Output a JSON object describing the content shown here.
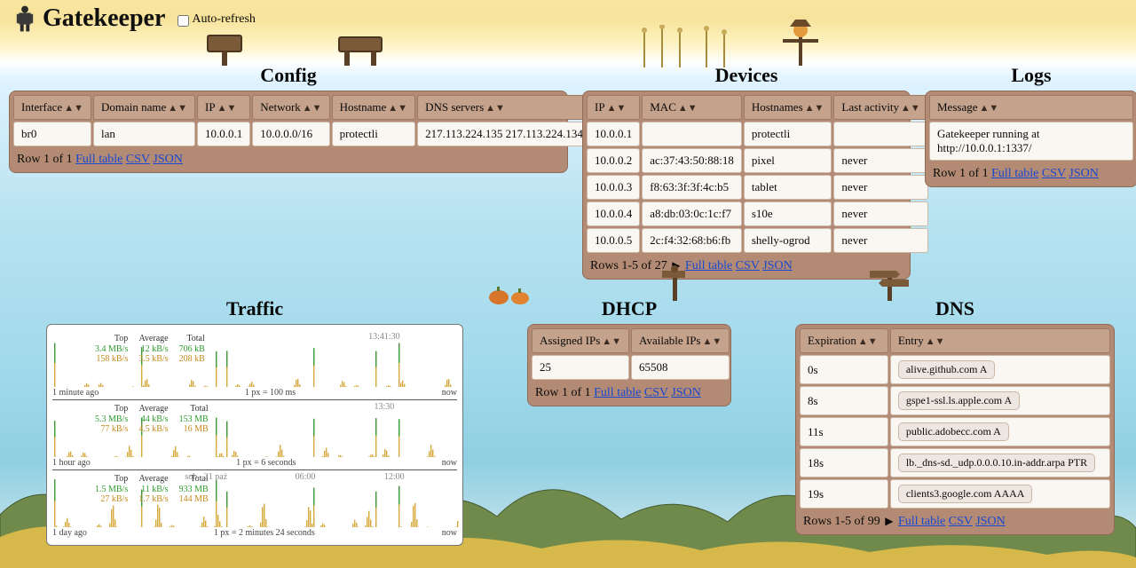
{
  "app": {
    "title": "Gatekeeper",
    "autorefresh_label": "Auto-refresh"
  },
  "config": {
    "title": "Config",
    "headers": {
      "interface": "Interface",
      "domain": "Domain name",
      "ip": "IP",
      "network": "Network",
      "hostname": "Hostname",
      "dns": "DNS servers"
    },
    "rows": [
      {
        "interface": "br0",
        "domain": "lan",
        "ip": "10.0.0.1",
        "network": "10.0.0.0/16",
        "hostname": "protectli",
        "dns": "217.113.224.135 217.113.224.134"
      }
    ],
    "footer": {
      "range": "Row 1 of 1",
      "full": "Full table",
      "csv": "CSV",
      "json": "JSON"
    }
  },
  "devices": {
    "title": "Devices",
    "headers": {
      "ip": "IP",
      "mac": "MAC",
      "hostnames": "Hostnames",
      "last": "Last activity"
    },
    "rows": [
      {
        "ip": "10.0.0.1",
        "mac": "",
        "hostnames": "protectli",
        "last": ""
      },
      {
        "ip": "10.0.0.2",
        "mac": "ac:37:43:50:88:18",
        "hostnames": "pixel",
        "last": "never"
      },
      {
        "ip": "10.0.0.3",
        "mac": "f8:63:3f:3f:4c:b5",
        "hostnames": "tablet",
        "last": "never"
      },
      {
        "ip": "10.0.0.4",
        "mac": "a8:db:03:0c:1c:f7",
        "hostnames": "s10e",
        "last": "never"
      },
      {
        "ip": "10.0.0.5",
        "mac": "2c:f4:32:68:b6:fb",
        "hostnames": "shelly-ogrod",
        "last": "never"
      }
    ],
    "footer": {
      "range": "Rows 1-5 of 27",
      "full": "Full table",
      "csv": "CSV",
      "json": "JSON"
    }
  },
  "logs": {
    "title": "Logs",
    "headers": {
      "message": "Message"
    },
    "rows": [
      {
        "message": "Gatekeeper running at http://10.0.0.1:1337/"
      }
    ],
    "footer": {
      "range": "Row 1 of 1",
      "full": "Full table",
      "csv": "CSV",
      "json": "JSON"
    }
  },
  "dhcp": {
    "title": "DHCP",
    "headers": {
      "assigned": "Assigned IPs",
      "available": "Available IPs"
    },
    "rows": [
      {
        "assigned": "25",
        "available": "65508"
      }
    ],
    "footer": {
      "range": "Row 1 of 1",
      "full": "Full table",
      "csv": "CSV",
      "json": "JSON"
    }
  },
  "dns": {
    "title": "DNS",
    "headers": {
      "expiration": "Expiration",
      "entry": "Entry"
    },
    "rows": [
      {
        "expiration": "0s",
        "entry": "alive.github.com A"
      },
      {
        "expiration": "8s",
        "entry": "gspe1-ssl.ls.apple.com A"
      },
      {
        "expiration": "11s",
        "entry": "public.adobecc.com A"
      },
      {
        "expiration": "18s",
        "entry": "lb._dns-sd._udp.0.0.0.10.in-addr.arpa PTR"
      },
      {
        "expiration": "19s",
        "entry": "clients3.google.com AAAA"
      }
    ],
    "footer": {
      "range": "Rows 1-5 of 99",
      "full": "Full table",
      "csv": "CSV",
      "json": "JSON"
    }
  },
  "traffic": {
    "title": "Traffic",
    "rows": [
      {
        "top1": "Top",
        "avg1": "Average",
        "tot1": "Total",
        "top_g": "3.4 MB/s",
        "avg_g": "12 kB/s",
        "tot_g": "706 kB",
        "top_y": "158 kB/s",
        "avg_y": "3.5 kB/s",
        "tot_y": "208 kB",
        "time": "13:41:30",
        "left": "1 minute ago",
        "mid": "1 px = 100 ms",
        "right": "now"
      },
      {
        "top1": "Top",
        "avg1": "Average",
        "tot1": "Total",
        "top_g": "5.3 MB/s",
        "avg_g": "44 kB/s",
        "tot_g": "153 MB",
        "top_y": "77 kB/s",
        "avg_y": "4.5 kB/s",
        "tot_y": "16 MB",
        "time": "13:30",
        "left": "1 hour ago",
        "mid": "1 px = 6 seconds",
        "right": "now"
      },
      {
        "top1": "Top",
        "avg1": "Average",
        "tot1": "Total",
        "top_g": "1.5 MB/s",
        "avg_g": "11 kB/s",
        "tot_g": "933 MB",
        "top_y": "27 kB/s",
        "avg_y": "1.7 kB/s",
        "tot_y": "144 MB",
        "time": "sob., 21 paź",
        "t2": "06:00",
        "t3": "12:00",
        "left": "1 day ago",
        "mid": "1 px = 2 minutes 24 seconds",
        "right": "now"
      }
    ]
  }
}
